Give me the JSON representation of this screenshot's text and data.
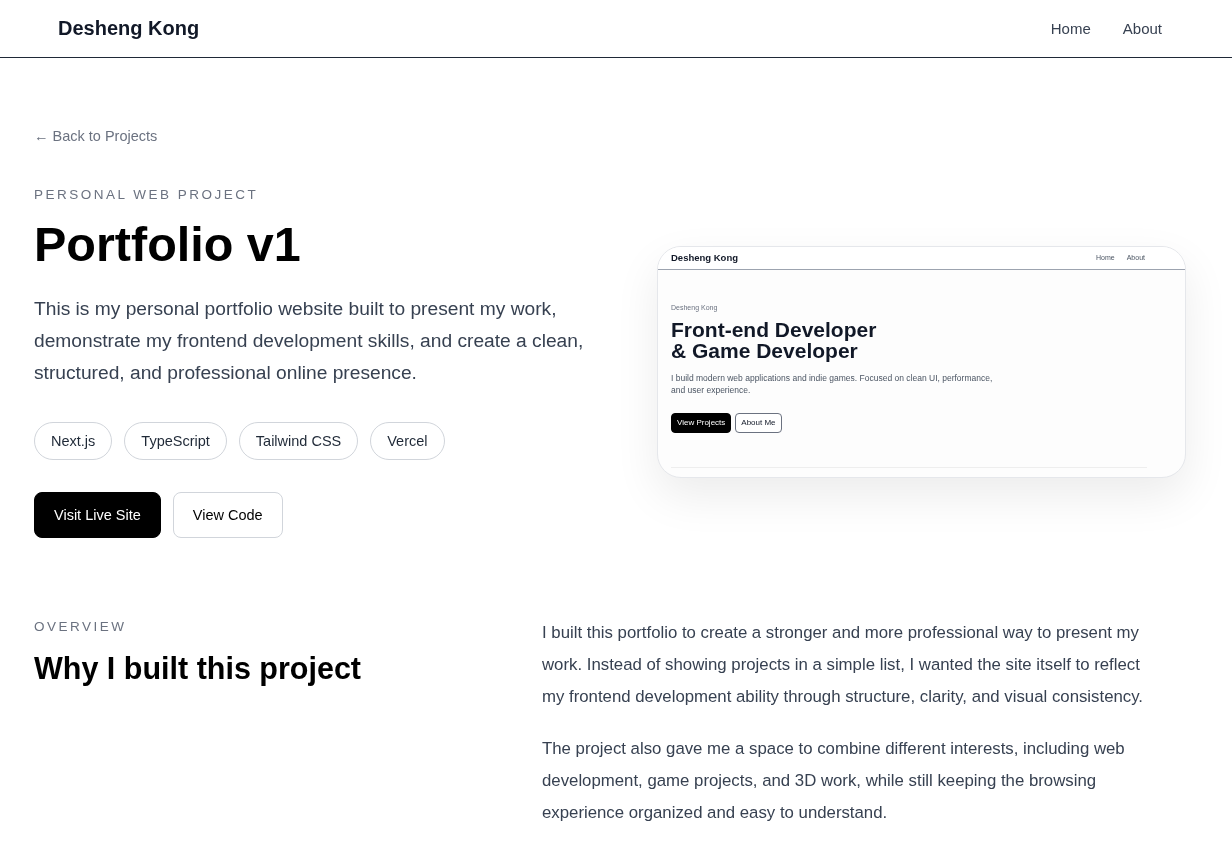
{
  "header": {
    "logo": "Desheng Kong",
    "nav": [
      {
        "label": "Home"
      },
      {
        "label": "About"
      }
    ]
  },
  "back_link": "← Back to Projects",
  "project": {
    "eyebrow": "PERSONAL WEB PROJECT",
    "title": "Portfolio v1",
    "description": "This is my personal portfolio website built to present my work, demonstrate my frontend development skills, and create a clean, structured, and professional online presence.",
    "tags": [
      "Next.js",
      "TypeScript",
      "Tailwind CSS",
      "Vercel"
    ],
    "actions": [
      {
        "label": "Visit Live Site",
        "kind": "primary"
      },
      {
        "label": "View Code",
        "kind": "secondary"
      }
    ]
  },
  "preview": {
    "logo": "Desheng Kong",
    "nav": [
      "Home",
      "About"
    ],
    "eyebrow": "Desheng Kong",
    "headline": [
      "Front-end Developer",
      "& Game Developer"
    ],
    "description": "I build modern web applications and indie games. Focused on clean UI, performance, and user experience.",
    "actions": [
      {
        "label": "View Projects",
        "kind": "primary"
      },
      {
        "label": "About Me",
        "kind": "secondary"
      }
    ]
  },
  "overview": {
    "eyebrow": "OVERVIEW",
    "heading": "Why I built this project",
    "paragraphs": [
      "I built this portfolio to create a stronger and more professional way to present my work. Instead of showing projects in a simple list, I wanted the site itself to reflect my frontend development ability through structure, clarity, and visual consistency.",
      "The project also gave me a space to combine different interests, including web development, game projects, and 3D work, while still keeping the browsing experience organized and easy to understand."
    ]
  }
}
